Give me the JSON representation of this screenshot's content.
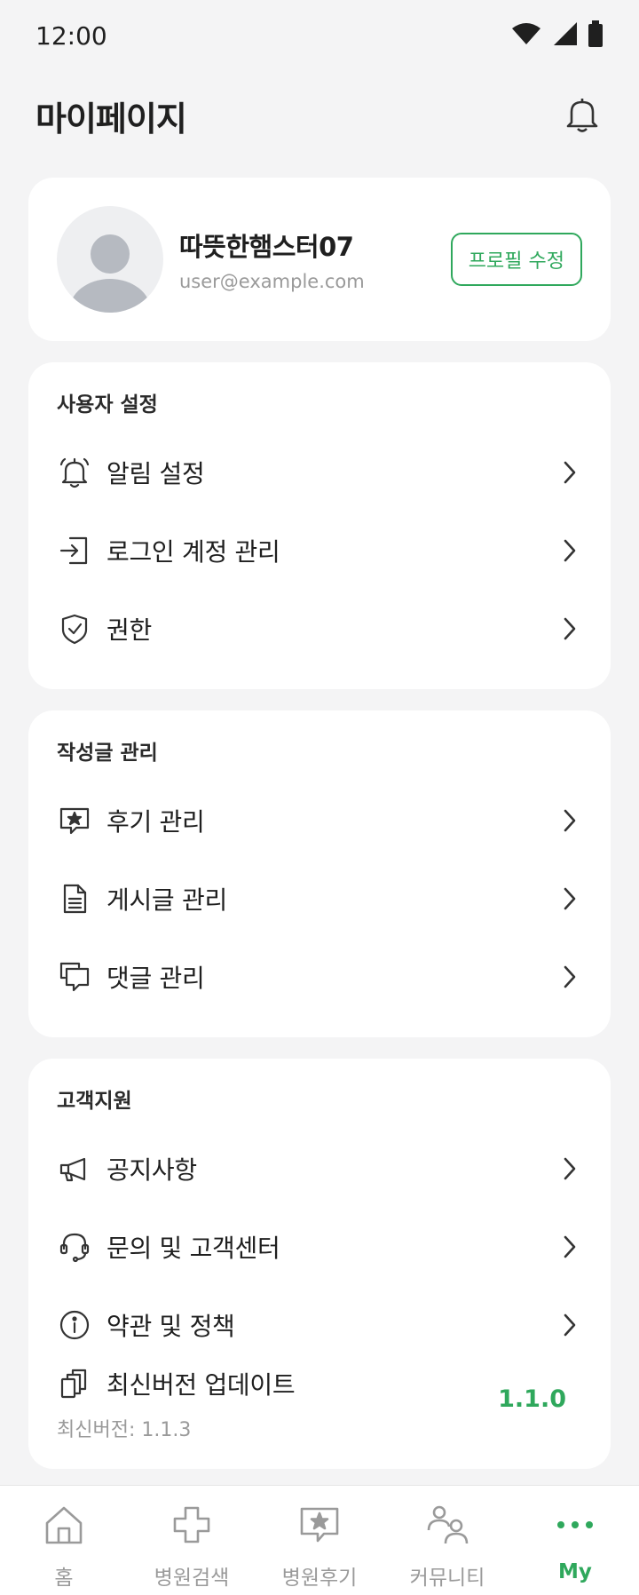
{
  "status_bar": {
    "time": "12:00"
  },
  "header": {
    "title": "마이페이지"
  },
  "profile": {
    "name": "따뜻한햄스터07",
    "email": "user@example.com",
    "edit_label": "프로필 수정"
  },
  "sections": [
    {
      "title": "사용자 설정",
      "items": [
        {
          "label": "알림 설정",
          "icon": "bell-icon"
        },
        {
          "label": "로그인 계정 관리",
          "icon": "login-icon"
        },
        {
          "label": "권한",
          "icon": "shield-check-icon"
        }
      ]
    },
    {
      "title": "작성글 관리",
      "items": [
        {
          "label": "후기 관리",
          "icon": "review-star-icon"
        },
        {
          "label": "게시글 관리",
          "icon": "document-icon"
        },
        {
          "label": "댓글 관리",
          "icon": "comments-icon"
        }
      ]
    },
    {
      "title": "고객지원",
      "items": [
        {
          "label": "공지사항",
          "icon": "megaphone-icon"
        },
        {
          "label": "문의 및 고객센터",
          "icon": "headset-icon"
        },
        {
          "label": "약관 및 정책",
          "icon": "info-icon"
        }
      ],
      "version": {
        "label": "최신버전 업데이트",
        "latest": "최신버전: 1.1.3",
        "current": "1.1.0"
      }
    }
  ],
  "nav": [
    {
      "label": "홈",
      "icon": "home-icon"
    },
    {
      "label": "병원검색",
      "icon": "hospital-cross-icon"
    },
    {
      "label": "병원후기",
      "icon": "review-icon"
    },
    {
      "label": "커뮤니티",
      "icon": "community-icon"
    },
    {
      "label": "My",
      "icon": "more-dots-icon",
      "active": true
    }
  ],
  "colors": {
    "accent": "#2fa85c",
    "background": "#f4f4f5",
    "muted": "#9a9a9a"
  }
}
